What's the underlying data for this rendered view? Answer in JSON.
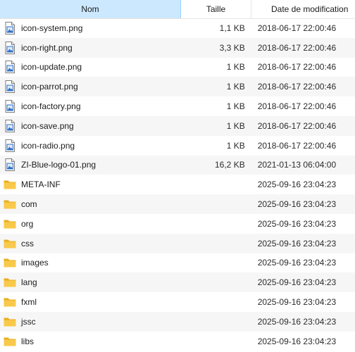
{
  "columns": {
    "name": "Nom",
    "size": "Taille",
    "date": "Date de modification"
  },
  "files": [
    {
      "name": "icon-system.png",
      "size": "1,1 KB",
      "date": "2018-06-17 22:00:46",
      "type": "image-file-icon"
    },
    {
      "name": "icon-right.png",
      "size": "3,3 KB",
      "date": "2018-06-17 22:00:46",
      "type": "image-file-icon"
    },
    {
      "name": "icon-update.png",
      "size": "1 KB",
      "date": "2018-06-17 22:00:46",
      "type": "image-file-icon"
    },
    {
      "name": "icon-parrot.png",
      "size": "1 KB",
      "date": "2018-06-17 22:00:46",
      "type": "image-file-icon"
    },
    {
      "name": "icon-factory.png",
      "size": "1 KB",
      "date": "2018-06-17 22:00:46",
      "type": "image-file-icon"
    },
    {
      "name": "icon-save.png",
      "size": "1 KB",
      "date": "2018-06-17 22:00:46",
      "type": "image-file-icon"
    },
    {
      "name": "icon-radio.png",
      "size": "1 KB",
      "date": "2018-06-17 22:00:46",
      "type": "image-file-icon"
    },
    {
      "name": "ZI-Blue-logo-01.png",
      "size": "16,2 KB",
      "date": "2021-01-13 06:04:00",
      "type": "image-file-icon"
    },
    {
      "name": "META-INF",
      "size": "",
      "date": "2025-09-16 23:04:23",
      "type": "folder-icon"
    },
    {
      "name": "com",
      "size": "",
      "date": "2025-09-16 23:04:23",
      "type": "folder-icon"
    },
    {
      "name": "org",
      "size": "",
      "date": "2025-09-16 23:04:23",
      "type": "folder-icon"
    },
    {
      "name": "css",
      "size": "",
      "date": "2025-09-16 23:04:23",
      "type": "folder-icon"
    },
    {
      "name": "images",
      "size": "",
      "date": "2025-09-16 23:04:23",
      "type": "folder-icon"
    },
    {
      "name": "lang",
      "size": "",
      "date": "2025-09-16 23:04:23",
      "type": "folder-icon"
    },
    {
      "name": "fxml",
      "size": "",
      "date": "2025-09-16 23:04:23",
      "type": "folder-icon"
    },
    {
      "name": "jssc",
      "size": "",
      "date": "2025-09-16 23:04:23",
      "type": "folder-icon"
    },
    {
      "name": "libs",
      "size": "",
      "date": "2025-09-16 23:04:23",
      "type": "folder-icon"
    }
  ],
  "colors": {
    "header_selected": "#cce8ff",
    "folder": "#f8c94a",
    "image_icon_accent": "#2f6fc4"
  }
}
